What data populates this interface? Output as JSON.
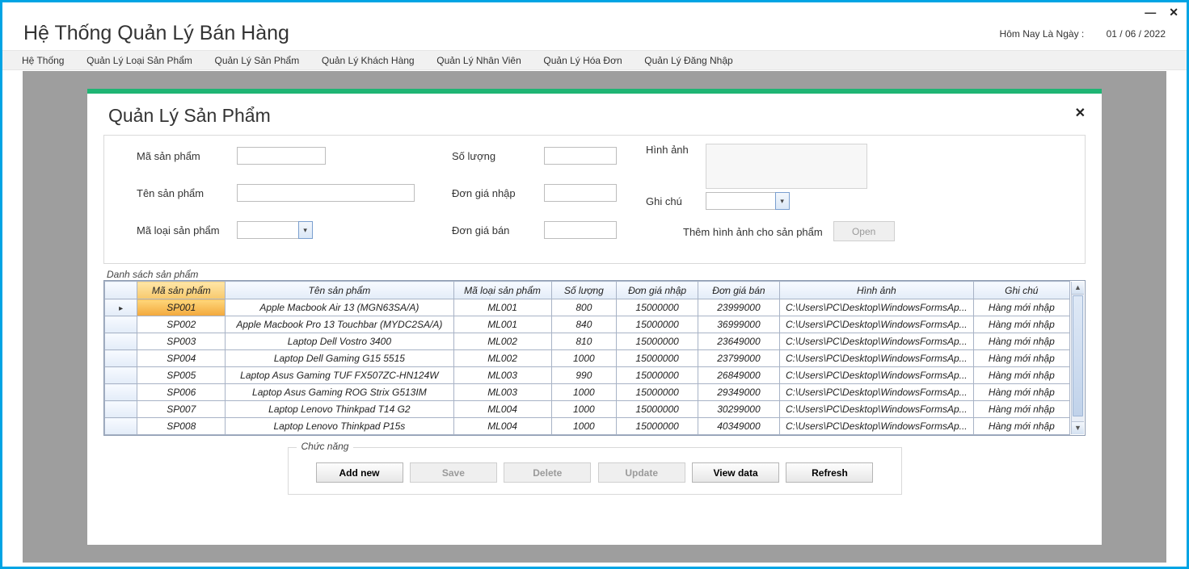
{
  "window": {
    "minimize": "—",
    "close": "✕"
  },
  "app": {
    "title": "Hệ Thống Quản Lý Bán Hàng",
    "today_label": "Hôm Nay Là Ngày :",
    "today_value": "01 / 06 / 2022"
  },
  "menu": {
    "items": [
      "Hệ Thống",
      "Quản Lý Loại Sản Phẩm",
      "Quản Lý Sản Phẩm",
      "Quản Lý Khách Hàng",
      "Quản Lý Nhân Viên",
      "Quản Lý Hóa Đơn",
      "Quản Lý Đăng Nhập"
    ]
  },
  "panel": {
    "title": "Quản Lý Sản Phẩm",
    "close": "✕"
  },
  "form": {
    "ma_sp": "Mã sản phẩm",
    "ten_sp": "Tên sản phẩm",
    "ma_loai": "Mã loại sản phẩm",
    "so_luong": "Số lượng",
    "don_gia_nhap": "Đơn giá nhập",
    "don_gia_ban": "Đơn giá bán",
    "hinh_anh": "Hình ảnh",
    "ghi_chu": "Ghi chú",
    "add_image": "Thêm hình ảnh cho sản phẩm",
    "open_btn": "Open"
  },
  "list_caption": "Danh sách sản phẩm",
  "columns": [
    "Mã sản phẩm",
    "Tên sản phẩm",
    "Mã loại sản phẩm",
    "Số lượng",
    "Đơn giá nhập",
    "Đơn giá bán",
    "Hình ảnh",
    "Ghi chú"
  ],
  "rows": [
    {
      "ma": "SP001",
      "ten": "Apple Macbook Air 13 (MGN63SA/A)",
      "loai": "ML001",
      "sl": "800",
      "nhap": "15000000",
      "ban": "23999000",
      "img": "C:\\Users\\PC\\Desktop\\WindowsFormsAp...",
      "gc": "Hàng mới nhập"
    },
    {
      "ma": "SP002",
      "ten": "Apple Macbook Pro 13 Touchbar (MYDC2SA/A)",
      "loai": "ML001",
      "sl": "840",
      "nhap": "15000000",
      "ban": "36999000",
      "img": "C:\\Users\\PC\\Desktop\\WindowsFormsAp...",
      "gc": "Hàng mới nhập"
    },
    {
      "ma": "SP003",
      "ten": "Laptop Dell Vostro 3400",
      "loai": "ML002",
      "sl": "810",
      "nhap": "15000000",
      "ban": "23649000",
      "img": "C:\\Users\\PC\\Desktop\\WindowsFormsAp...",
      "gc": "Hàng mới nhập"
    },
    {
      "ma": "SP004",
      "ten": "Laptop Dell Gaming G15 5515",
      "loai": "ML002",
      "sl": "1000",
      "nhap": "15000000",
      "ban": "23799000",
      "img": "C:\\Users\\PC\\Desktop\\WindowsFormsAp...",
      "gc": "Hàng mới nhập"
    },
    {
      "ma": "SP005",
      "ten": "Laptop Asus Gaming TUF FX507ZC-HN124W",
      "loai": "ML003",
      "sl": "990",
      "nhap": "15000000",
      "ban": "26849000",
      "img": "C:\\Users\\PC\\Desktop\\WindowsFormsAp...",
      "gc": "Hàng mới nhập"
    },
    {
      "ma": "SP006",
      "ten": "Laptop Asus Gaming ROG Strix G513IM",
      "loai": "ML003",
      "sl": "1000",
      "nhap": "15000000",
      "ban": "29349000",
      "img": "C:\\Users\\PC\\Desktop\\WindowsFormsAp...",
      "gc": "Hàng mới nhập"
    },
    {
      "ma": "SP007",
      "ten": "Laptop Lenovo Thinkpad T14 G2",
      "loai": "ML004",
      "sl": "1000",
      "nhap": "15000000",
      "ban": "30299000",
      "img": "C:\\Users\\PC\\Desktop\\WindowsFormsAp...",
      "gc": "Hàng mới nhập"
    },
    {
      "ma": "SP008",
      "ten": "Laptop Lenovo Thinkpad P15s",
      "loai": "ML004",
      "sl": "1000",
      "nhap": "15000000",
      "ban": "40349000",
      "img": "C:\\Users\\PC\\Desktop\\WindowsFormsAp...",
      "gc": "Hàng mới nhập"
    }
  ],
  "func": {
    "caption": "Chức năng",
    "add": "Add new",
    "save": "Save",
    "delete": "Delete",
    "update": "Update",
    "view": "View data",
    "refresh": "Refresh"
  }
}
